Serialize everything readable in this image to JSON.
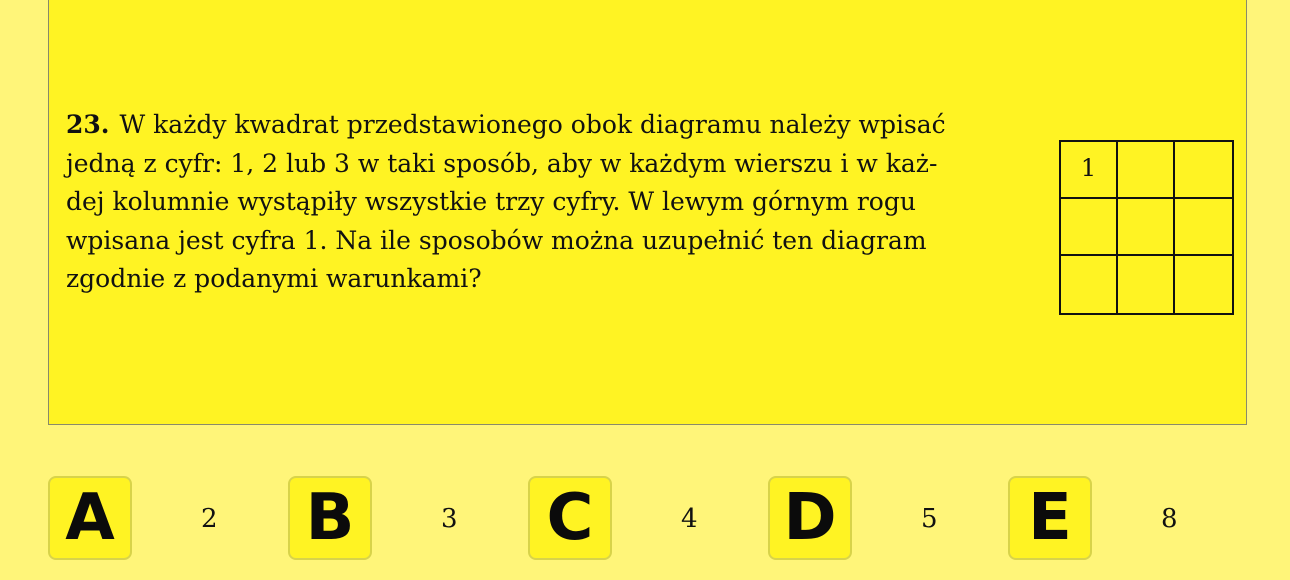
{
  "question": {
    "number": "23.",
    "text": "W każdy kwadrat przedstawionego obok diagramu należy wpisać jedną z cyfr: 1, 2 lub 3 w taki sposób, aby w każdym wierszu i w każ-dej kolumnie wystąpiły wszystkie trzy cyfry. W lewym górnym rogu wpisana jest cyfra 1. Na ile sposobów można uzupełnić ten diagram zgodnie z podanymi warunkami?",
    "lines": [
      "W każdy kwadrat przedstawionego obok diagramu należy wpisać",
      "jedną z cyfr: 1, 2 lub 3 w taki sposób, aby w każdym wierszu i w każ-",
      "dej kolumnie wystąpiły wszystkie trzy cyfry. W lewym górnym rogu",
      "wpisana jest cyfra 1. Na ile sposobów można uzupełnić ten diagram",
      "zgodnie z podanymi warunkami?"
    ]
  },
  "grid": {
    "cells": [
      "1",
      "",
      "",
      "",
      "",
      "",
      "",
      "",
      ""
    ]
  },
  "answers": [
    {
      "letter": "A",
      "value": "2"
    },
    {
      "letter": "B",
      "value": "3"
    },
    {
      "letter": "C",
      "value": "4"
    },
    {
      "letter": "D",
      "value": "5"
    },
    {
      "letter": "E",
      "value": "8"
    }
  ]
}
